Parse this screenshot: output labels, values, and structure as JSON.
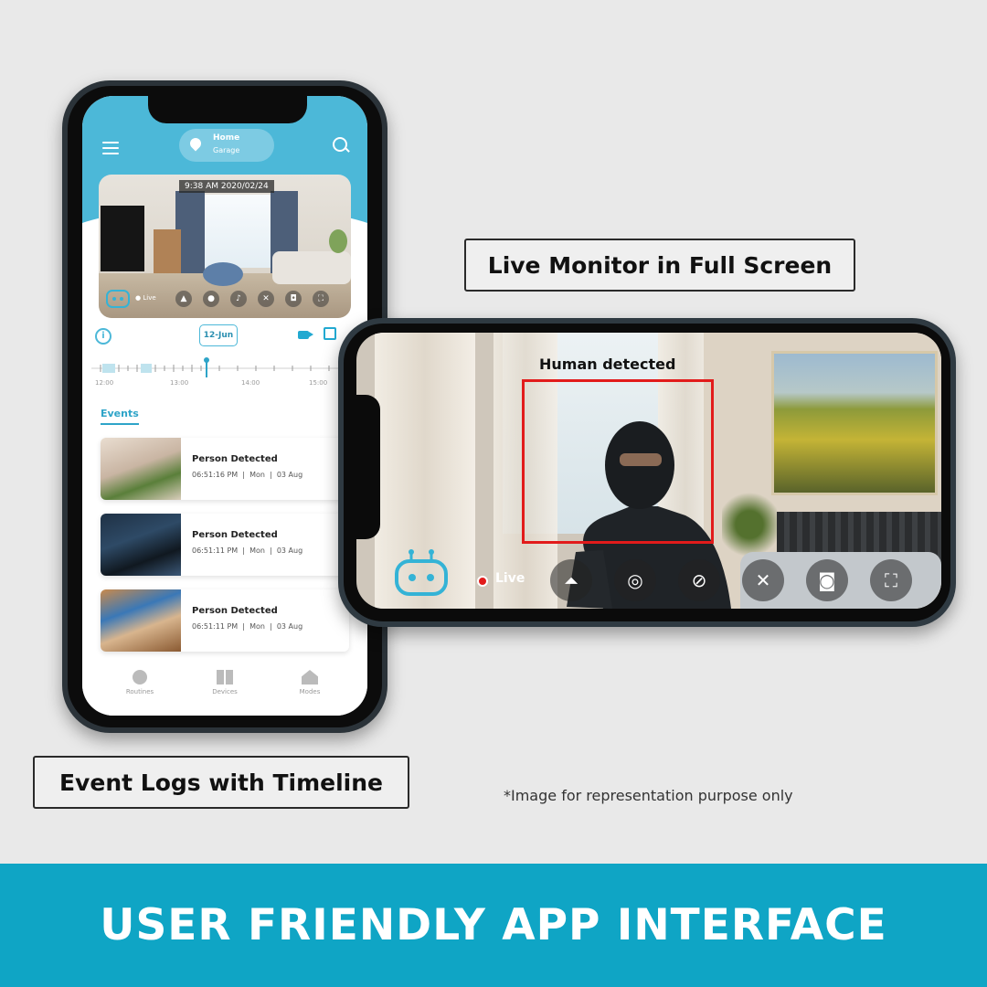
{
  "colors": {
    "accent": "#4cb8d8",
    "banner": "#0fa5c5",
    "detection_box": "#e21b1b"
  },
  "callouts": {
    "live_monitor": "Live Monitor in Full Screen",
    "event_logs": "Event Logs with Timeline"
  },
  "footnote": "*Image for representation purpose only",
  "banner": "USER FRIENDLY APP INTERFACE",
  "app": {
    "header": {
      "location_title": "Home",
      "location_sub": "Garage",
      "menu_icon": "hamburger-menu-icon",
      "search_icon": "search-icon"
    },
    "camera": {
      "timestamp": "9:38 AM 2020/02/24",
      "live_label": "Live"
    },
    "timeline": {
      "date": "12-Jun",
      "times": [
        "12:00",
        "13:00",
        "14:00",
        "15:00"
      ]
    },
    "events_title": "Events",
    "events": [
      {
        "title": "Person Detected",
        "time": "06:51:16 PM",
        "day": "Mon",
        "date": "03 Aug"
      },
      {
        "title": "Person Detected",
        "time": "06:51:11 PM",
        "day": "Mon",
        "date": "03 Aug"
      },
      {
        "title": "Person Detected",
        "time": "06:51:11 PM",
        "day": "Mon",
        "date": "03 Aug"
      }
    ],
    "nav": [
      {
        "label": "Routines",
        "icon": "clock-icon"
      },
      {
        "label": "Devices",
        "icon": "grid-icon"
      },
      {
        "label": "Modes",
        "icon": "home-icon"
      }
    ]
  },
  "live_view": {
    "detection_label": "Human detected",
    "live_label": "Live",
    "controls": [
      "siren-icon",
      "record-icon",
      "mute-mic-icon",
      "mute-speaker-icon",
      "camera-snapshot-icon",
      "fullscreen-icon"
    ]
  }
}
